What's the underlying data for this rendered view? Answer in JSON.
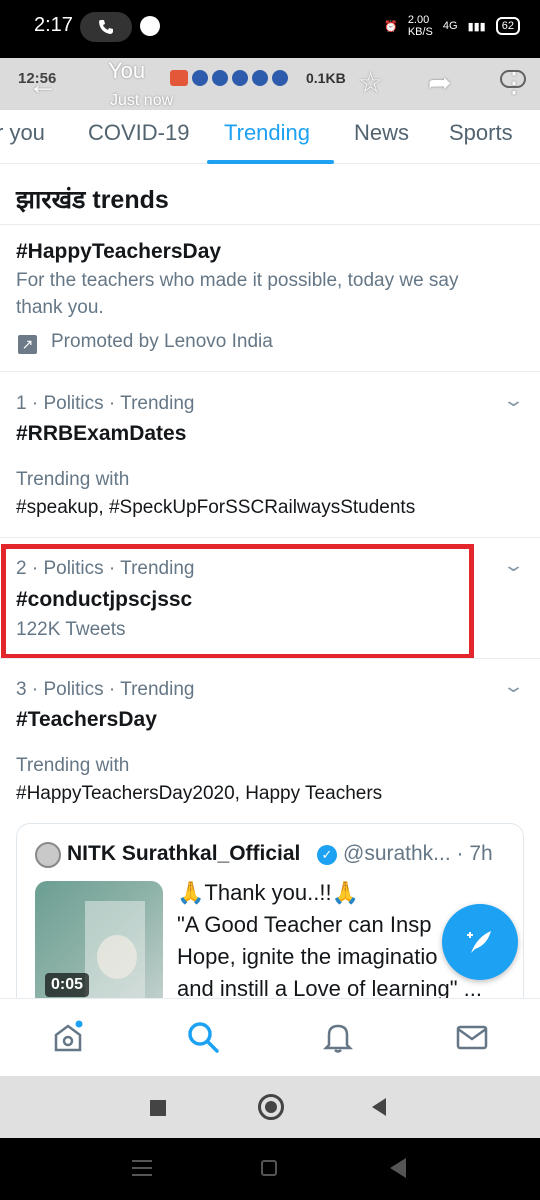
{
  "status": {
    "time": "2:17",
    "speed": "2.00",
    "speed_unit": "KB/S",
    "network": "4G",
    "battery": "62"
  },
  "ghost_status": {
    "time": "12:56",
    "data": "0.1KB"
  },
  "header": {
    "title": "You",
    "subtitle": "Just now"
  },
  "tabs": [
    {
      "label": "r you"
    },
    {
      "label": "COVID-19"
    },
    {
      "label": "Trending"
    },
    {
      "label": "News"
    },
    {
      "label": "Sports"
    }
  ],
  "section_title": "झारखंड trends",
  "promoted": {
    "hashtag": "#HappyTeachersDay",
    "desc_line1": "For the teachers who made it possible, today we say",
    "desc_line2": "thank you.",
    "by": "Promoted by Lenovo India"
  },
  "trends": [
    {
      "meta": "1 · Politics · Trending",
      "hashtag": "#RRBExamDates",
      "with_label": "Trending with",
      "with": "#speakup, #SpeckUpForSSCRailwaysStudents"
    },
    {
      "meta": "2 · Politics · Trending",
      "hashtag": "#conductjpscjssc",
      "count": "122K Tweets"
    },
    {
      "meta": "3 · Politics · Trending",
      "hashtag": "#TeachersDay",
      "with_label": "Trending with",
      "with": "#HappyTeachersDay2020, Happy Teachers"
    }
  ],
  "tweet": {
    "name": "NITK Surathkal_Official",
    "handle": "@surathk...",
    "time": "· 7h",
    "video_duration": "0:05",
    "line1": "🙏Thank you..!!🙏",
    "line2": "\"A Good Teacher can Insp",
    "line3": "Hope, ignite the imaginatio",
    "line4": "and instill a Love of learning\" ..."
  },
  "colors": {
    "accent": "#1da1f2",
    "highlight": "#e3262b"
  }
}
